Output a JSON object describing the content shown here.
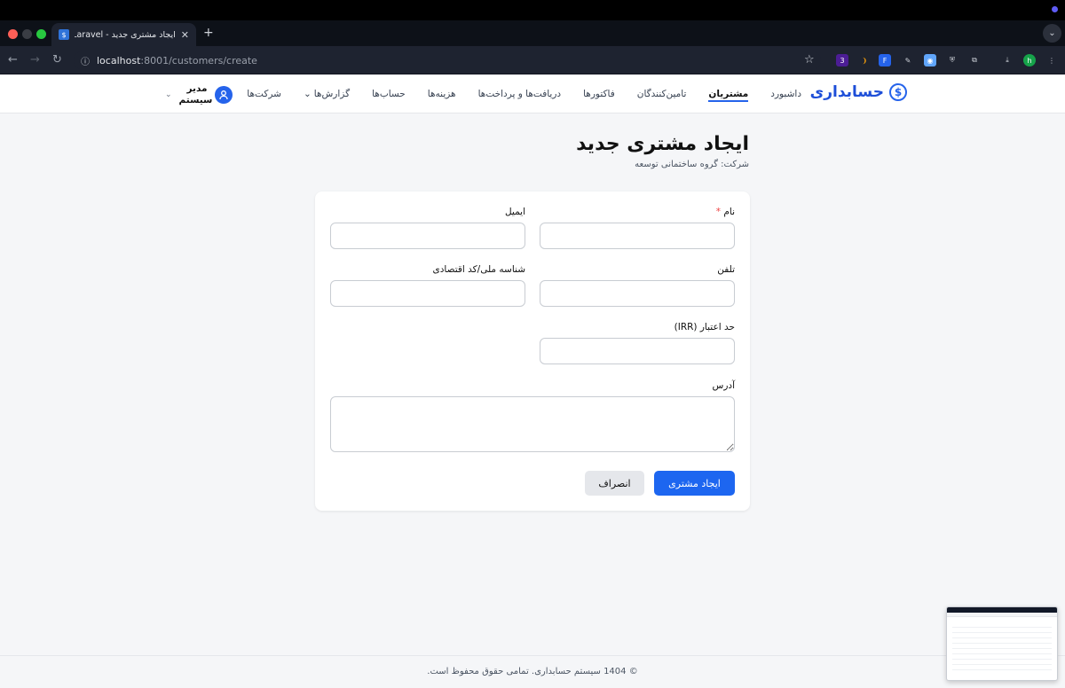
{
  "browser": {
    "tab_title": "ایجاد مشتری جدید - Laravel",
    "tab_favicon": "$",
    "new_tab": "+",
    "url_host": "localhost",
    "url_rest": ":8001/customers/create",
    "ext_badge": "3",
    "profile_initial": "h"
  },
  "header": {
    "brand_icon": "$",
    "brand_name": "حسابداری",
    "nav": [
      "داشبورد",
      "مشتریان",
      "تامین‌کنندگان",
      "فاکتورها",
      "دریافت‌ها و پرداخت‌ها",
      "هزینه‌ها",
      "حساب‌ها",
      "گزارش‌ها",
      "شرکت‌ها"
    ],
    "active_nav": "مشتریان",
    "user_name_line1": "مدیر",
    "user_name_line2": "سیستم"
  },
  "page": {
    "title": "ایجاد مشتری جدید",
    "subtitle": "شرکت: گروه ساختمانی توسعه"
  },
  "form": {
    "name_label": "نام",
    "name_required": "*",
    "email_label": "ایمیل",
    "phone_label": "تلفن",
    "national_id_label": "شناسه ملی/کد اقتصادی",
    "credit_limit_label": "حد اعتبار (IRR)",
    "address_label": "آدرس",
    "submit_label": "ایجاد مشتری",
    "cancel_label": "انصراف",
    "values": {
      "name": "",
      "email": "",
      "phone": "",
      "national_id": "",
      "credit_limit": "",
      "address": ""
    }
  },
  "footer": {
    "text": "© 1404 سیستم حسابداری. تمامی حقوق محفوظ است."
  },
  "colors": {
    "accent": "#1d66f0",
    "brand": "#1d4ed8"
  }
}
